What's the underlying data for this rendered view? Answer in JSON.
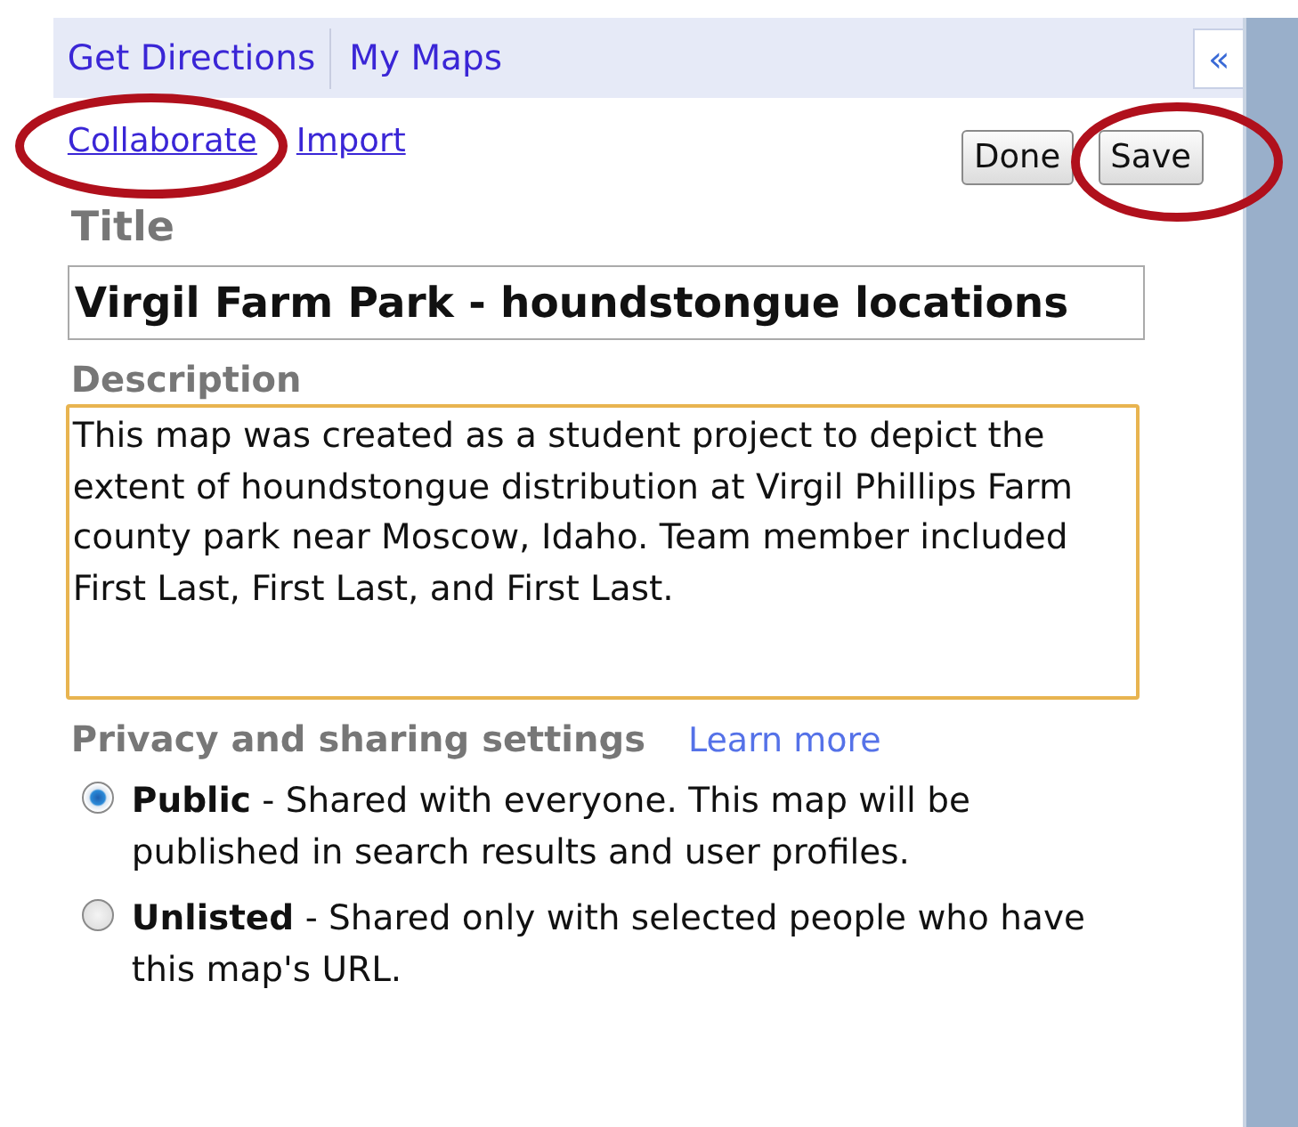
{
  "tabs": [
    {
      "label": "Get Directions"
    },
    {
      "label": "My Maps"
    }
  ],
  "collapse_button": "«",
  "links": [
    {
      "label": "Collaborate",
      "circled": true
    },
    {
      "label": "Import",
      "circled": false
    }
  ],
  "buttons": [
    {
      "label": "Done",
      "circled": false
    },
    {
      "label": "Save",
      "circled": true
    }
  ],
  "title": {
    "label": "Title",
    "value": "Virgil Farm Park - houndstongue locations"
  },
  "description": {
    "label": "Description",
    "value": "This map was created as a student project to depict the extent of houndstongue distribution at Virgil Phillips Farm county park near Moscow, Idaho. Team member included First Last, First Last, and First Last."
  },
  "privacy": {
    "label": "Privacy and sharing settings",
    "link": "Learn more",
    "options": [
      {
        "text": "**Public** - Shared with everyone. This map will be published in search results and user profiles.",
        "selected": true
      },
      {
        "text": "**Unlisted** - Shared only with selected people who have this map's URL.",
        "selected": false
      }
    ]
  }
}
